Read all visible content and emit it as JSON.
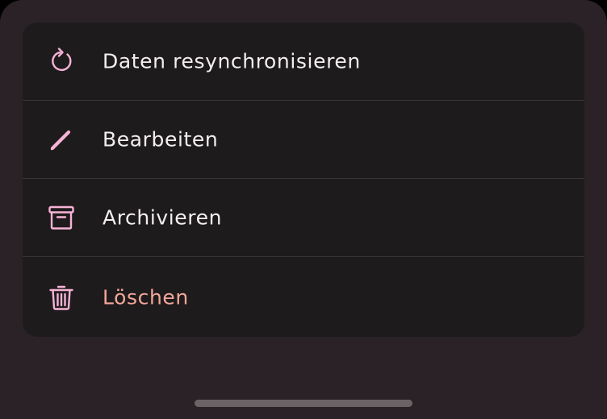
{
  "colors": {
    "sheet_background": "#2a2226",
    "menu_background": "#1e1b1c",
    "divider": "#3a3436",
    "icon_accent": "#f6b3d6",
    "label_text": "#f3eef0",
    "danger_text": "#f2a79a",
    "home_indicator": "#6a6466"
  },
  "menu": {
    "items": [
      {
        "label": "Daten resynchronisieren",
        "icon": "refresh-icon"
      },
      {
        "label": "Bearbeiten",
        "icon": "pencil-icon"
      },
      {
        "label": "Archivieren",
        "icon": "archive-icon"
      },
      {
        "label": "Löschen",
        "icon": "trash-icon",
        "destructive": true
      }
    ]
  }
}
